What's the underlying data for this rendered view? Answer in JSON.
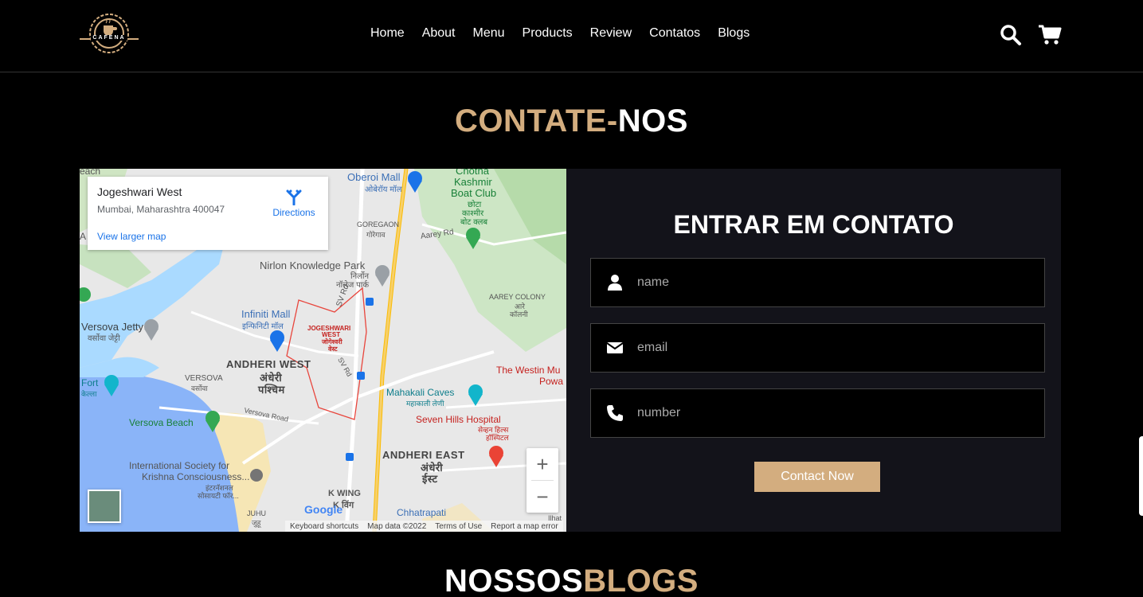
{
  "header": {
    "logo_text": "CAFENA",
    "nav": [
      "Home",
      "About",
      "Menu",
      "Products",
      "Review",
      "Contatos",
      "Blogs"
    ]
  },
  "contact": {
    "title_part1": "CONTATE-",
    "title_part2": "NOS"
  },
  "map": {
    "place_title": "Jogeshwari West",
    "place_address": "Mumbai, Maharashtra 400047",
    "directions_label": "Directions",
    "larger_map_label": "View larger map",
    "labels": {
      "oberoi": "Oberoi Mall",
      "oberoi_hi": "ओबेरॉय मॉल",
      "chotha": "Chotha",
      "kashmir": "Kashmir",
      "boat": "Boat Club",
      "chota_hi": "छोटा",
      "kashmir_hi": "काश्मीर",
      "boat_hi": "बोट क्लब",
      "goregaon": "GOREGAON",
      "goregaon_hi": "गोरेगाव",
      "aarey_rd": "Aarey Rd",
      "nirlon": "Nirlon Knowledge Park",
      "nirlon_hi1": "निर्लोन",
      "nirlon_hi2": "नॉलेज पार्क",
      "aarey_colony": "AAREY COLONY",
      "aarey_hi1": "आरे",
      "aarey_hi2": "कॉलनी",
      "versova_jetty": "Versova Jetty",
      "versova_jetty_hi": "वर्सोवा जेट्टी",
      "infiniti": "Infiniti Mall",
      "infiniti_hi": "इन्फिनिटी मॉल",
      "jogeshwari1": "JOGESHWARI",
      "jogeshwari2": "WEST",
      "jogeshwari_hi1": "जोगेश्वरी",
      "jogeshwari_hi2": "वेस्ट",
      "andheri_west": "ANDHERI WEST",
      "andheri_west_hi1": "अंधेरी",
      "andheri_west_hi2": "पश्चिम",
      "westin": "The Westin Mu",
      "westin2": "Powa",
      "versova": "VERSOVA",
      "versova_hi": "वर्सोवा",
      "fort": "Fort",
      "fort_hi": "केल्ला",
      "mahakali": "Mahakali Caves",
      "mahakali_hi": "महाकाली लेणी",
      "versova_road": "Versova Road",
      "seven_hills": "Seven Hills Hospital",
      "seven_hills_hi1": "सेव्हन हिल्स",
      "seven_hills_hi2": "हॉस्पिटल",
      "versova_beach": "Versova Beach",
      "andheri_east": "ANDHERI EAST",
      "andheri_east_hi1": "अंधेरी",
      "andheri_east_hi2": "ईस्ट",
      "iskcon1": "International Society for",
      "iskcon2": "Krishna Consciousness...",
      "iskcon_hi1": "इंटरनॅशनल",
      "iskcon_hi2": "सोसायटी फॉर...",
      "k_wing": "K WING",
      "k_wing_hi": "K विंग",
      "juhu": "JUHU",
      "juhu_hi": "जुहू",
      "chhatrapati": "Chhatrapati",
      "sv_rd": "SV Rd",
      "sv_rd2": "SV Rd",
      "beach_top": "each",
      "a_left": "A",
      "hat": "Ilhat"
    },
    "google": "Google",
    "attribution": [
      "Keyboard shortcuts",
      "Map data ©2022",
      "Terms of Use",
      "Report a map error"
    ]
  },
  "form": {
    "title": "ENTRAR EM CONTATO",
    "name_placeholder": "name",
    "email_placeholder": "email",
    "number_placeholder": "number",
    "submit_label": "Contact Now"
  },
  "blogs": {
    "title_part1": "NOSSOS",
    "title_part2": "BLOGS"
  },
  "colors": {
    "accent": "#d3ad7f",
    "form_bg": "#13131a"
  }
}
